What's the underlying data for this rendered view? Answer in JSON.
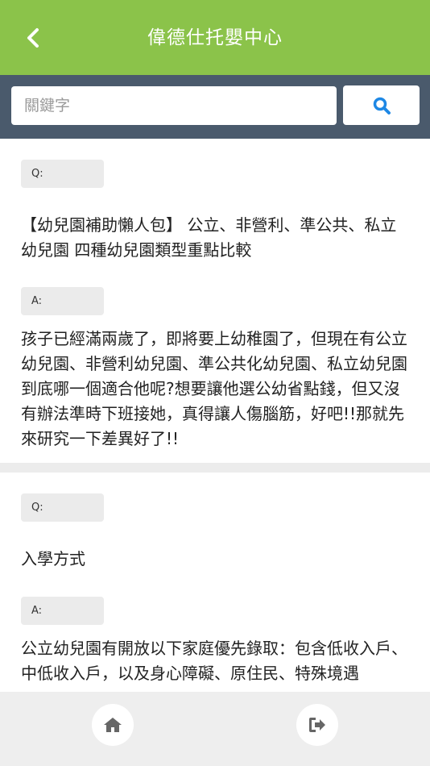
{
  "header": {
    "title": "偉德仕托嬰中心",
    "back_icon": "chevron-left-icon"
  },
  "search": {
    "placeholder": "關鍵字",
    "value": "",
    "button_icon": "search-icon"
  },
  "colors": {
    "header_bg": "#8bc34a",
    "search_bar_bg": "#4a5a6c",
    "search_icon": "#1e88e5"
  },
  "faq": [
    {
      "q_label": "Q:",
      "question": "【幼兒園補助懶人包】 公立、非營利、準公共、私立幼兒園 四種幼兒園類型重點比較",
      "a_label": "A:",
      "answer": "孩子已經滿兩歲了，即將要上幼稚園了，但現在有公立幼兒園、非營利幼兒園、準公共化幼兒園、私立幼兒園到底哪一個適合他呢?想要讓他選公幼省點錢，但又沒有辦法準時下班接她，真得讓人傷腦筋，好吧!!那就先來研究一下差異好了!!"
    },
    {
      "q_label": "Q:",
      "question": "入學方式",
      "a_label": "A:",
      "answer": "公立幼兒園有開放以下家庭優先錄取：包含低收入戶、中低收入戶，以及身心障礙、原住民、特殊境遇"
    }
  ],
  "footer": {
    "home_icon": "home-icon",
    "logout_icon": "logout-icon"
  }
}
